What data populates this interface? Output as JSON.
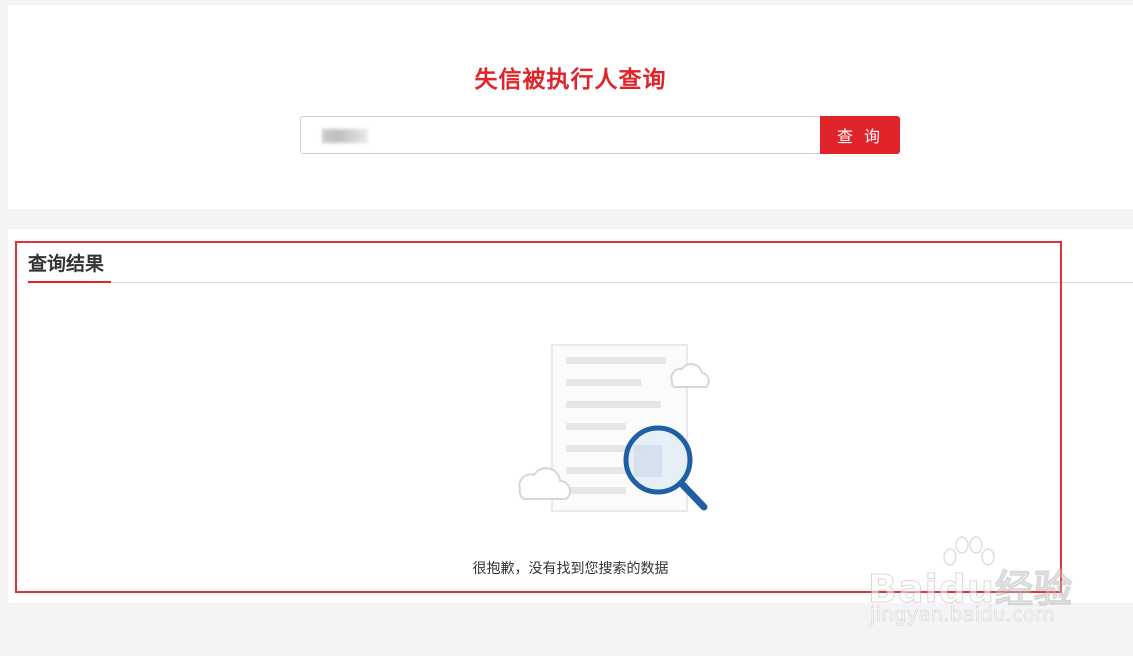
{
  "search": {
    "title": "失信被执行人查询",
    "input_value": "",
    "button_label": "查 询"
  },
  "results": {
    "header": "查询结果",
    "empty_message": "很抱歉，没有找到您搜索的数据"
  },
  "watermark": {
    "brand": "Baidu经验",
    "url": "jingyan.baidu.com"
  },
  "colors": {
    "accent": "#e0242a",
    "magnifier": "#1f5fa6"
  },
  "icons": [
    "document-icon",
    "magnifier-icon",
    "cloud-icon",
    "baidu-paw-icon"
  ]
}
